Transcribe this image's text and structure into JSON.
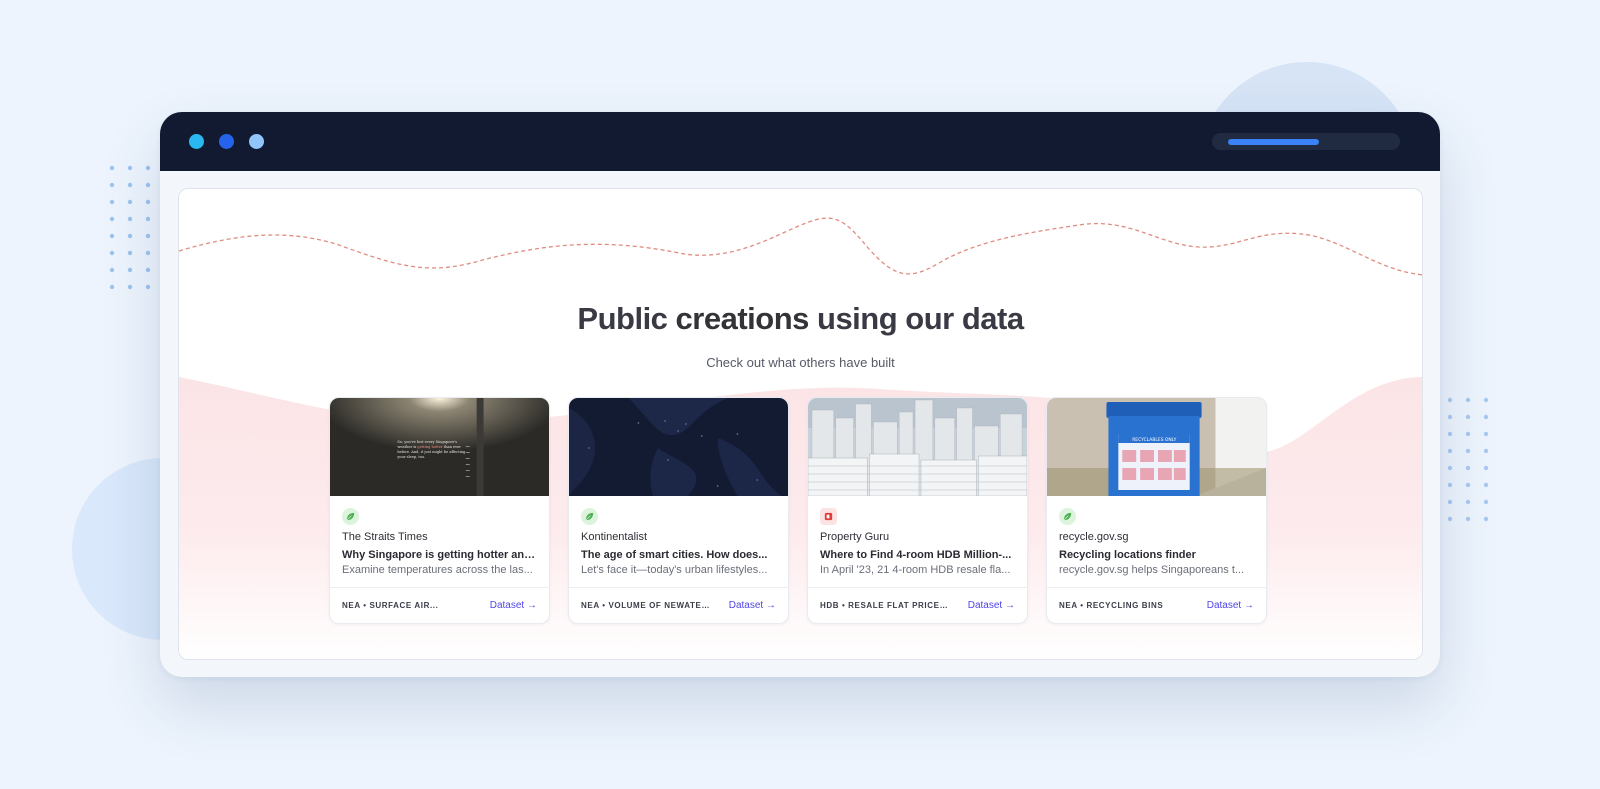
{
  "hero": {
    "title_prefix": "Public ",
    "title_bold": "creations",
    "title_suffix": " using our data",
    "subtitle": "Check out what others have built"
  },
  "address_bar": {
    "loaded_fraction": 0.52
  },
  "colors": {
    "accent_link": "#4f46e5",
    "titlebar": "#111a30",
    "wave_line": "#e08c80"
  },
  "cards": [
    {
      "source_icon": "leaf-icon",
      "source": "The Straits Times",
      "title": "Why Singapore is getting hotter and...",
      "description": "Examine temperatures across the las...",
      "tag": "NEA • SURFACE AIR...",
      "link": "Dataset →",
      "image_text": "So, you've lost every Singapore's weather is getting hotter than ever before. And, it just might be affecting your sleep, too."
    },
    {
      "source_icon": "leaf-icon",
      "source": "Kontinentalist",
      "title": "The age of smart cities. How does...",
      "description": "Let's face it—today's urban lifestyles...",
      "tag": "NEA • VOLUME OF NEWATER...",
      "link": "Dataset →"
    },
    {
      "source_icon": "property-guru-icon",
      "source": "Property Guru",
      "title": "Where to Find 4-room HDB Million-...",
      "description": "In April '23, 21 4-room HDB resale fla...",
      "tag": "HDB • RESALE FLAT PRICES...",
      "link": "Dataset →"
    },
    {
      "source_icon": "leaf-icon",
      "source": "recycle.gov.sg",
      "title": "Recycling locations finder",
      "description": "recycle.gov.sg helps Singaporeans t...",
      "tag": "NEA • RECYCLING BINS",
      "link": "Dataset →",
      "image_text": "RECYCLABLES ONLY"
    }
  ]
}
